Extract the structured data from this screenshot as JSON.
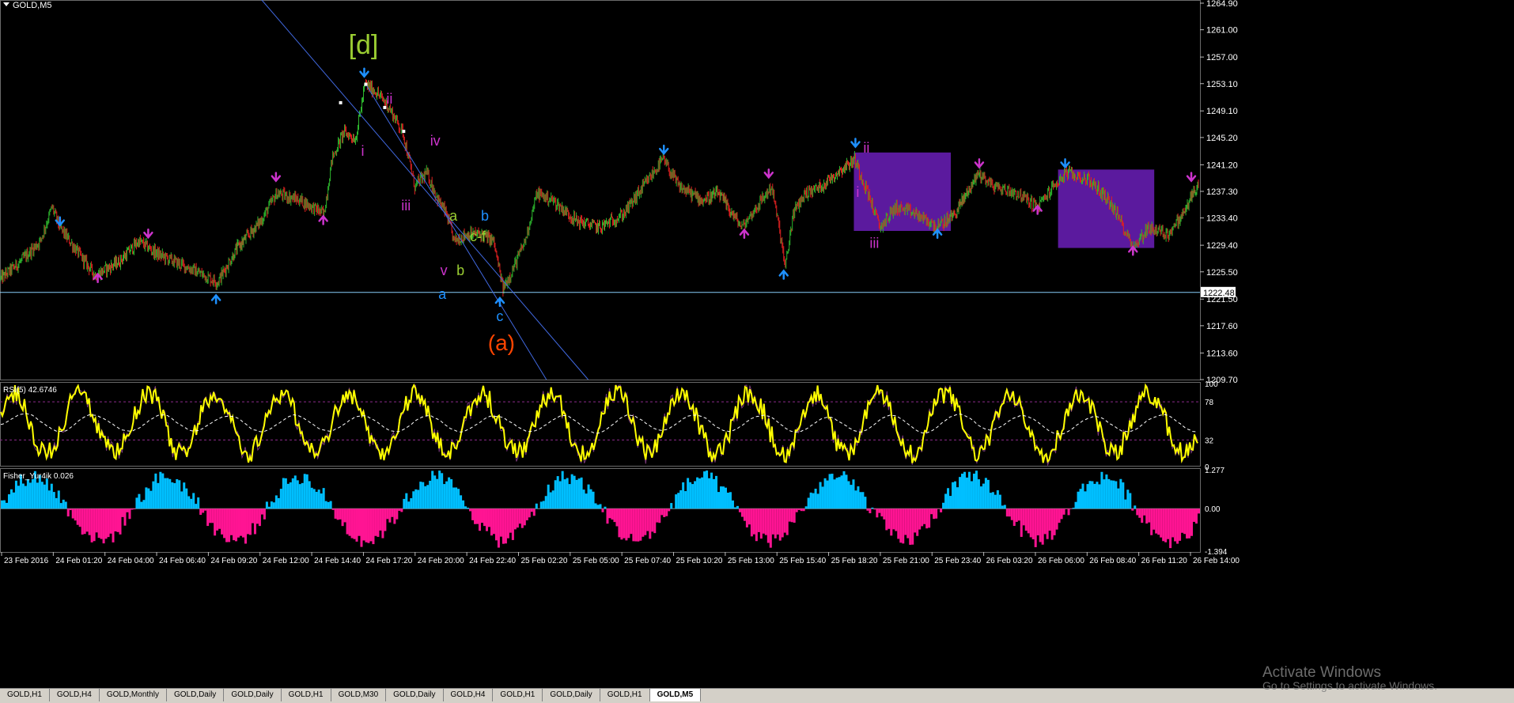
{
  "window": {
    "title": "GOLD,M5"
  },
  "chart_data": [
    {
      "type": "candlestick",
      "title": "GOLD,M5",
      "ylim": [
        1209.7,
        1264.9
      ],
      "y_ticks": [
        "1264.90",
        "1261.00",
        "1257.00",
        "1253.10",
        "1249.10",
        "1245.20",
        "1241.20",
        "1237.30",
        "1233.40",
        "1229.40",
        "1225.50",
        "1221.50",
        "1217.60",
        "1213.60",
        "1209.70"
      ],
      "x_ticks": [
        "23 Feb 2016",
        "24 Feb 01:20",
        "24 Feb 04:00",
        "24 Feb 06:40",
        "24 Feb 09:20",
        "24 Feb 12:00",
        "24 Feb 14:40",
        "24 Feb 17:20",
        "24 Feb 20:00",
        "24 Feb 22:40",
        "25 Feb 02:20",
        "25 Feb 05:00",
        "25 Feb 07:40",
        "25 Feb 10:20",
        "25 Feb 13:00",
        "25 Feb 15:40",
        "25 Feb 18:20",
        "25 Feb 21:00",
        "25 Feb 23:40",
        "26 Feb 03:20",
        "26 Feb 06:00",
        "26 Feb 08:40",
        "26 Feb 11:20",
        "26 Feb 14:00"
      ],
      "price_anchors": [
        [
          0,
          1224.5
        ],
        [
          25,
          1227
        ],
        [
          50,
          1230
        ],
        [
          65,
          1235
        ],
        [
          75,
          1232
        ],
        [
          100,
          1228
        ],
        [
          120,
          1225
        ],
        [
          150,
          1227
        ],
        [
          175,
          1230
        ],
        [
          200,
          1228
        ],
        [
          240,
          1226
        ],
        [
          275,
          1224
        ],
        [
          300,
          1229
        ],
        [
          330,
          1233
        ],
        [
          350,
          1237
        ],
        [
          380,
          1236
        ],
        [
          410,
          1234
        ],
        [
          420,
          1242
        ],
        [
          435,
          1246
        ],
        [
          450,
          1245
        ],
        [
          462,
          1253
        ],
        [
          475,
          1252
        ],
        [
          490,
          1250
        ],
        [
          510,
          1246
        ],
        [
          525,
          1238
        ],
        [
          540,
          1240
        ],
        [
          555,
          1236
        ],
        [
          565,
          1234
        ],
        [
          575,
          1230
        ],
        [
          590,
          1231
        ],
        [
          610,
          1231
        ],
        [
          625,
          1230
        ],
        [
          637,
          1223
        ],
        [
          650,
          1226
        ],
        [
          665,
          1230
        ],
        [
          680,
          1237
        ],
        [
          700,
          1236
        ],
        [
          730,
          1233
        ],
        [
          760,
          1232
        ],
        [
          790,
          1234
        ],
        [
          815,
          1238
        ],
        [
          840,
          1242
        ],
        [
          860,
          1238
        ],
        [
          890,
          1236
        ],
        [
          910,
          1237
        ],
        [
          940,
          1232
        ],
        [
          965,
          1236
        ],
        [
          978,
          1238
        ],
        [
          990,
          1230
        ],
        [
          995,
          1226
        ],
        [
          1005,
          1234
        ],
        [
          1020,
          1237
        ],
        [
          1040,
          1238
        ],
        [
          1060,
          1240
        ],
        [
          1083,
          1242
        ],
        [
          1100,
          1237
        ],
        [
          1115,
          1232
        ],
        [
          1135,
          1235
        ],
        [
          1160,
          1234
        ],
        [
          1188,
          1232
        ],
        [
          1210,
          1234
        ],
        [
          1240,
          1240
        ],
        [
          1260,
          1238
        ],
        [
          1290,
          1237
        ],
        [
          1315,
          1235
        ],
        [
          1335,
          1238
        ],
        [
          1352,
          1240
        ],
        [
          1380,
          1239
        ],
        [
          1405,
          1236
        ],
        [
          1420,
          1233
        ],
        [
          1437,
          1229
        ],
        [
          1455,
          1232
        ],
        [
          1480,
          1231
        ],
        [
          1500,
          1234
        ],
        [
          1512,
          1237
        ],
        [
          1517,
          1238
        ]
      ],
      "elliott_labels": [
        {
          "text": "[d]",
          "color": "#9acd32",
          "price": 1257.5,
          "bar": 460
        },
        {
          "text": "ii",
          "color": "#cc33cc",
          "price": 1250.2,
          "bar": 493
        },
        {
          "text": "i",
          "color": "#cc33cc",
          "price": 1242.5,
          "bar": 459
        },
        {
          "text": "iv",
          "color": "#cc33cc",
          "price": 1244.0,
          "bar": 551
        },
        {
          "text": "iii",
          "color": "#cc33cc",
          "price": 1234.5,
          "bar": 514
        },
        {
          "text": "a",
          "color": "#9acd32",
          "price": 1233.0,
          "bar": 574
        },
        {
          "text": "b",
          "color": "#1e90ff",
          "price": 1233.0,
          "bar": 614
        },
        {
          "text": "c-f",
          "color": "#9acd32",
          "price": 1230.0,
          "bar": 605
        },
        {
          "text": "v",
          "color": "#cc33cc",
          "price": 1225.0,
          "bar": 562
        },
        {
          "text": "b",
          "color": "#9acd32",
          "price": 1225.0,
          "bar": 583
        },
        {
          "text": "a",
          "color": "#1e90ff",
          "price": 1221.5,
          "bar": 560
        },
        {
          "text": "c",
          "color": "#1e90ff",
          "price": 1218.3,
          "bar": 633
        },
        {
          "text": "(a)",
          "color": "#ff4500",
          "price": 1214.0,
          "bar": 635
        },
        {
          "text": "ii",
          "color": "#cc33cc",
          "price": 1243.0,
          "bar": 1098
        },
        {
          "text": "i",
          "color": "#cc33cc",
          "price": 1236.5,
          "bar": 1087
        },
        {
          "text": "iii",
          "color": "#cc33cc",
          "price": 1229.0,
          "bar": 1108
        }
      ],
      "fractal_markers": [
        {
          "bar": 75,
          "price": 1232.0,
          "dir": "down",
          "color": "#1e90ff"
        },
        {
          "bar": 123,
          "price": 1225.5,
          "dir": "up",
          "color": "#cc33cc"
        },
        {
          "bar": 187,
          "price": 1230.2,
          "dir": "down",
          "color": "#cc33cc"
        },
        {
          "bar": 273,
          "price": 1222.4,
          "dir": "up",
          "color": "#1e90ff"
        },
        {
          "bar": 349,
          "price": 1238.5,
          "dir": "down",
          "color": "#cc33cc"
        },
        {
          "bar": 409,
          "price": 1234.0,
          "dir": "up",
          "color": "#cc33cc"
        },
        {
          "bar": 461,
          "price": 1253.8,
          "dir": "down",
          "color": "#1e90ff"
        },
        {
          "bar": 633,
          "price": 1222.0,
          "dir": "up",
          "color": "#1e90ff"
        },
        {
          "bar": 841,
          "price": 1242.5,
          "dir": "down",
          "color": "#1e90ff"
        },
        {
          "bar": 943,
          "price": 1232.0,
          "dir": "up",
          "color": "#cc33cc"
        },
        {
          "bar": 974,
          "price": 1239.0,
          "dir": "down",
          "color": "#cc33cc"
        },
        {
          "bar": 993,
          "price": 1226.0,
          "dir": "up",
          "color": "#1e90ff"
        },
        {
          "bar": 1084,
          "price": 1243.5,
          "dir": "down",
          "color": "#1e90ff"
        },
        {
          "bar": 1188,
          "price": 1232.0,
          "dir": "up",
          "color": "#1e90ff"
        },
        {
          "bar": 1241,
          "price": 1240.5,
          "dir": "down",
          "color": "#cc33cc"
        },
        {
          "bar": 1315,
          "price": 1235.5,
          "dir": "up",
          "color": "#cc33cc"
        },
        {
          "bar": 1350,
          "price": 1240.5,
          "dir": "down",
          "color": "#1e90ff"
        },
        {
          "bar": 1436,
          "price": 1229.5,
          "dir": "up",
          "color": "#cc33cc"
        },
        {
          "bar": 1510,
          "price": 1238.5,
          "dir": "down",
          "color": "#cc33cc"
        }
      ],
      "horizontal_line": {
        "price": 1222.48,
        "label": "1222.48",
        "color": "#87cefa"
      },
      "trend_channel": [
        {
          "bar1": 330,
          "price1": 1265.5,
          "bar2": 745,
          "price2": 1209.7
        },
        {
          "bar1": 462,
          "price1": 1253.2,
          "bar2": 692,
          "price2": 1209.7
        }
      ],
      "channel_anchors": [
        {
          "bar": 431,
          "price": 1250.3
        },
        {
          "bar": 487,
          "price": 1249.6
        },
        {
          "bar": 511,
          "price": 1246.1
        },
        {
          "bar": 463,
          "price": 1253.0
        }
      ],
      "rectangles": [
        {
          "bar1": 1082,
          "price1": 1243.0,
          "bar2": 1205,
          "price2": 1231.5,
          "color": "#5b1a9e"
        },
        {
          "bar1": 1341,
          "price1": 1240.5,
          "bar2": 1463,
          "price2": 1229.0,
          "color": "#5b1a9e"
        }
      ],
      "colors": {
        "up": "#2db52d",
        "down": "#e02020",
        "background": "#000000"
      }
    },
    {
      "type": "line",
      "title": "RSI(5) 42.6746",
      "ylim": [
        0,
        100
      ],
      "y_ticks": [
        "100",
        "78",
        "32",
        "0"
      ],
      "levels": [
        78,
        32
      ],
      "series": [
        {
          "color": "#ffff00"
        }
      ],
      "last_value": 42.6746
    },
    {
      "type": "bar",
      "title": "Fisher_Yur4ik 0.026",
      "ylim": [
        -1.394,
        1.277
      ],
      "y_ticks": [
        "1.277",
        "0.00",
        "-1.394"
      ],
      "colors": {
        "positive": "#00bfff",
        "negative": "#ff1493"
      },
      "last_value": 0.026
    }
  ],
  "tabs": [
    "GOLD,H1",
    "GOLD,H4",
    "GOLD,Monthly",
    "GOLD,Daily",
    "GOLD,Daily",
    "GOLD,H1",
    "GOLD,M30",
    "GOLD,Daily",
    "GOLD,H4",
    "GOLD,H1",
    "GOLD,Daily",
    "GOLD,H1",
    "GOLD,M5"
  ],
  "watermark": {
    "line1": "Activate Windows",
    "line2": "Go to Settings to activate Windows."
  }
}
